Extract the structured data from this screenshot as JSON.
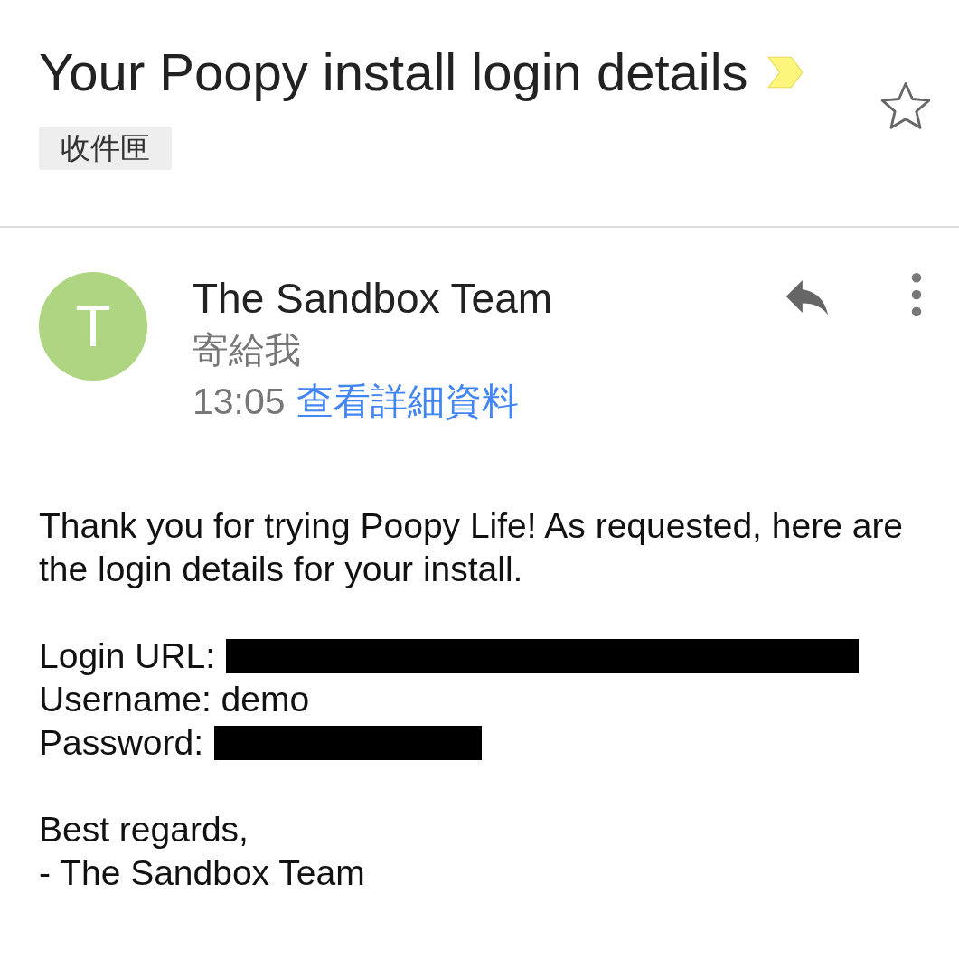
{
  "subject": {
    "title": "Your Poopy install login details",
    "important": true,
    "starred": false,
    "label": "收件匣"
  },
  "message": {
    "avatar_letter": "T",
    "sender": "The Sandbox Team",
    "recipient": "寄給我",
    "time": "13:05",
    "details_link": "查看詳細資料",
    "body": [
      "Thank you for trying Poopy Life! As requested, here are the login details for your install."
    ],
    "fields": [
      {
        "label": "Login URL:",
        "kind": "redacted"
      },
      {
        "label": "Username: demo",
        "kind": "plain"
      },
      {
        "label": "Password:",
        "kind": "redacted"
      }
    ],
    "closing": [
      "Best regards,",
      "- The Sandbox Team"
    ]
  }
}
